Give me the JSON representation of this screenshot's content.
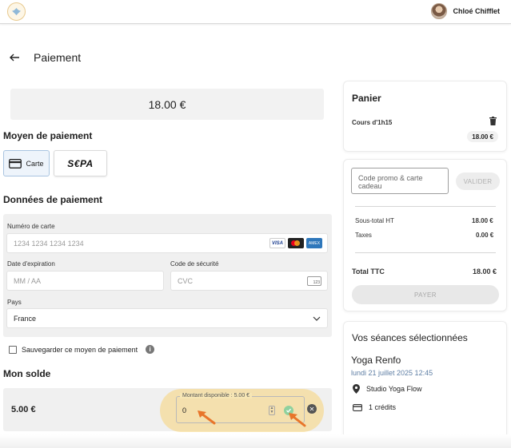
{
  "header": {
    "logo_name": "logo-icon",
    "user_name": "Chloé Chifflet"
  },
  "page": {
    "title": "Paiement",
    "amount": "18.00 €"
  },
  "payment_method": {
    "title": "Moyen de paiement",
    "card_label": "Carte",
    "sepa_label": "S€PA"
  },
  "payment_data": {
    "title": "Données de paiement",
    "card_number_label": "Numéro de carte",
    "card_number_placeholder": "1234 1234 1234 1234",
    "expiry_label": "Date d'expiration",
    "expiry_placeholder": "MM / AA",
    "security_label": "Code de sécurité",
    "security_placeholder": "CVC",
    "cvc_icon_text": "123",
    "country_label": "Pays",
    "country_value": "France",
    "card_brands": {
      "visa": "VISA",
      "amex": "AMEX"
    },
    "save_label": "Sauvegarder ce moyen de paiement"
  },
  "balance": {
    "title": "Mon solde",
    "value": "5.00 €",
    "available_label": "Montant disponible : 5.00 €",
    "amount_input": "0"
  },
  "cart": {
    "title": "Panier",
    "item_name": "Cours d'1h15",
    "item_price": "18.00 €",
    "promo_placeholder": "Code promo & carte cadeau",
    "validate_label": "VALIDER",
    "subtotal_label": "Sous-total HT",
    "subtotal_value": "18.00 €",
    "taxes_label": "Taxes",
    "taxes_value": "0.00 €",
    "total_label": "Total TTC",
    "total_value": "18.00 €",
    "pay_label": "PAYER"
  },
  "sessions": {
    "title": "Vos séances sélectionnées",
    "name": "Yoga Renfo",
    "datetime": "lundi 21 juillet 2025 12:45",
    "location": "Studio Yoga Flow",
    "credits": "1 crédits"
  },
  "colors": {
    "highlight": "#f7d378",
    "arrow": "#e8752a",
    "link_blue": "#5f7fa5",
    "selected_border": "#a9c4e0"
  }
}
